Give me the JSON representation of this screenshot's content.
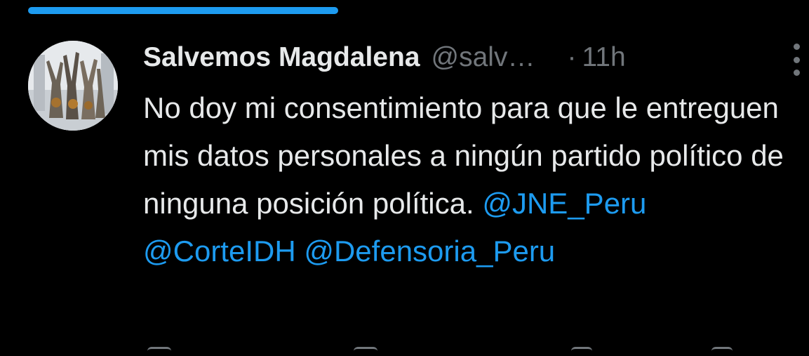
{
  "colors": {
    "background": "#000000",
    "text_primary": "#e7e9ea",
    "text_secondary": "#71767b",
    "accent": "#1d9bf0"
  },
  "progress": {
    "value": 1.0
  },
  "tweet": {
    "display_name": "Salvemos Magdalena",
    "handle": "@salv…",
    "separator": "·",
    "time": "11h",
    "avatar": {
      "icon": "statue-photo-avatar"
    },
    "body_text": "No doy mi consentimiento para que le entreguen mis datos personales a ningún partido político de ninguna posición política.",
    "mentions": [
      "@JNE_Peru",
      "@CorteIDH",
      "@Defensoria_Peru"
    ]
  },
  "more_menu": {
    "icon": "more-vertical-icon"
  }
}
